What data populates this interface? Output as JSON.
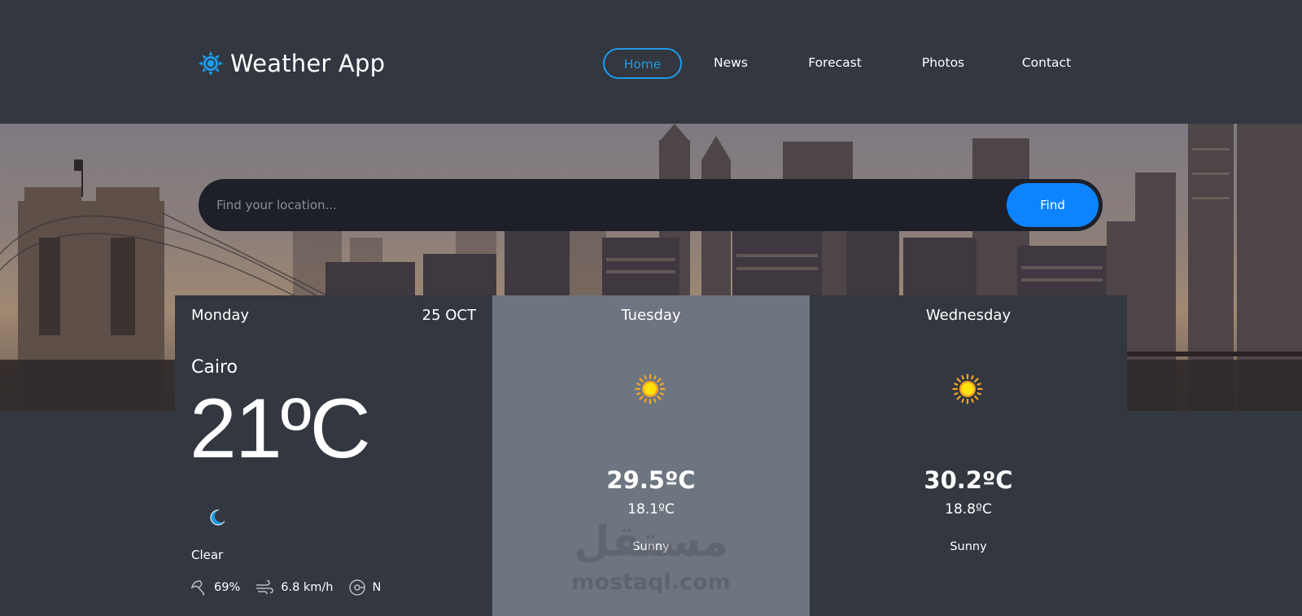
{
  "header": {
    "logo_text": "Weather App",
    "logo_icon": "sun-gear-icon",
    "nav": [
      {
        "label": "Home",
        "active": true
      },
      {
        "label": "News",
        "active": false
      },
      {
        "label": "Forecast",
        "active": false
      },
      {
        "label": "Photos",
        "active": false
      },
      {
        "label": "Contact",
        "active": false
      }
    ]
  },
  "search": {
    "placeholder": "Find your location...",
    "value": "",
    "button_label": "Find"
  },
  "forecast": {
    "today": {
      "day": "Monday",
      "date": "25 OCT",
      "city": "Cairo",
      "temp": "21ºC",
      "icon": "moon-icon",
      "condition": "Clear",
      "humidity": "69%",
      "wind_speed": "6.8 km/h",
      "wind_direction": "N"
    },
    "days": [
      {
        "day": "Tuesday",
        "icon": "sun-icon",
        "max_temp": "29.5ºC",
        "min_temp": "18.1ºC",
        "condition": "Sunny"
      },
      {
        "day": "Wednesday",
        "icon": "sun-icon",
        "max_temp": "30.2ºC",
        "min_temp": "18.8ºC",
        "condition": "Sunny"
      }
    ]
  },
  "watermark": {
    "arabic": "مستقل",
    "latin": "mostaql.com"
  },
  "colors": {
    "background": "#323740",
    "accent": "#1e9be8",
    "find_button": "#0d83fd",
    "search_bar": "#1d1f29",
    "card_highlight": "#6d7580",
    "sun": "#f6c90e"
  }
}
